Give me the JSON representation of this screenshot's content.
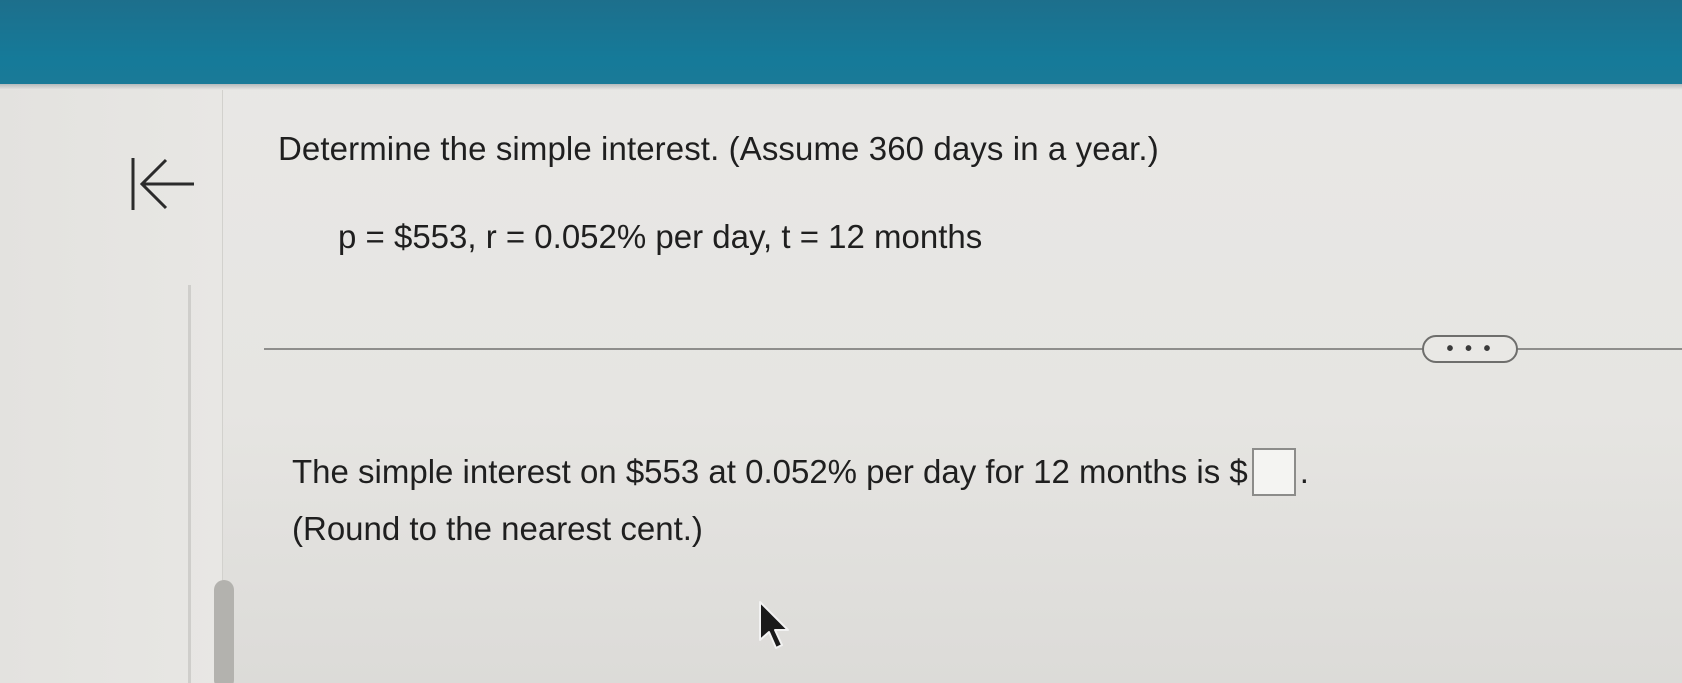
{
  "question": {
    "title": "Determine the simple interest. (Assume 360 days in a year.)",
    "given": "p = $553, r = 0.052% per day, t = 12 months"
  },
  "toolbar": {
    "more_label": "• • •"
  },
  "answer": {
    "prompt": "The simple interest on $553 at 0.052% per day for 12 months is $",
    "suffix": ".",
    "value": "",
    "note": "(Round to the nearest cent.)"
  },
  "icons": {
    "collapse": "collapse-left-icon",
    "cursor": "mouse-pointer-icon"
  },
  "colors": {
    "header": "#157a99",
    "background": "#e8e7e4",
    "text": "#1f1f1f"
  }
}
